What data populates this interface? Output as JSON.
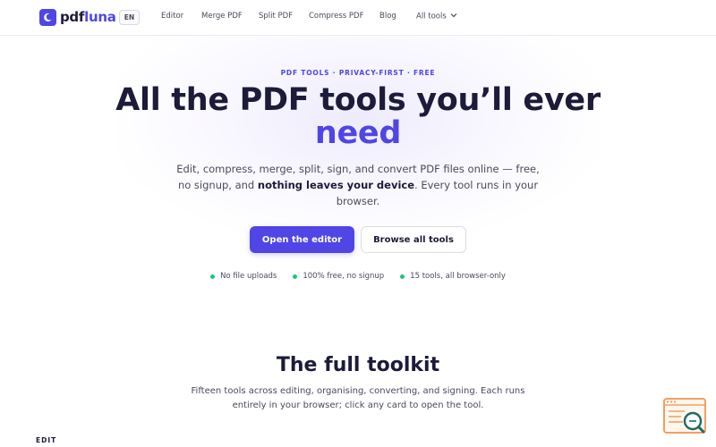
{
  "header": {
    "logo_main": "pdf",
    "logo_accent": "luna",
    "lang": "EN",
    "nav": [
      {
        "label": "Editor"
      },
      {
        "label": "Merge PDF"
      },
      {
        "label": "Split PDF"
      },
      {
        "label": "Compress PDF"
      },
      {
        "label": "Blog"
      },
      {
        "label": "All tools"
      }
    ]
  },
  "hero": {
    "eyebrow": "PDF TOOLS · PRIVACY-FIRST · FREE",
    "title_main": "All the PDF tools you’ll ever",
    "title_accent": "need",
    "lede_before": "Edit, compress, merge, split, sign, and convert PDF files online — free, no signup, and ",
    "lede_bold": "nothing leaves your device",
    "lede_after": ". Every tool runs in your browser.",
    "primary_button": "Open the editor",
    "secondary_button": "Browse all tools",
    "perks": [
      "No file uploads",
      "100% free, no signup",
      "15 tools, all browser-only"
    ]
  },
  "toolkit": {
    "title": "The full toolkit",
    "subtitle": "Fifteen tools across editing, organising, converting, and signing. Each runs entirely in your browser; click any card to open the tool.",
    "first_section": "EDIT"
  },
  "colors": {
    "brand": "#4f46e5",
    "perk_dot": "#22c37a",
    "helper_orange": "#f0a060",
    "helper_teal": "#1f6b6b"
  },
  "icons": {
    "logo": "moon-icon",
    "nav_dropdown": "chevron-down-icon",
    "helper": "search-document-icon"
  }
}
